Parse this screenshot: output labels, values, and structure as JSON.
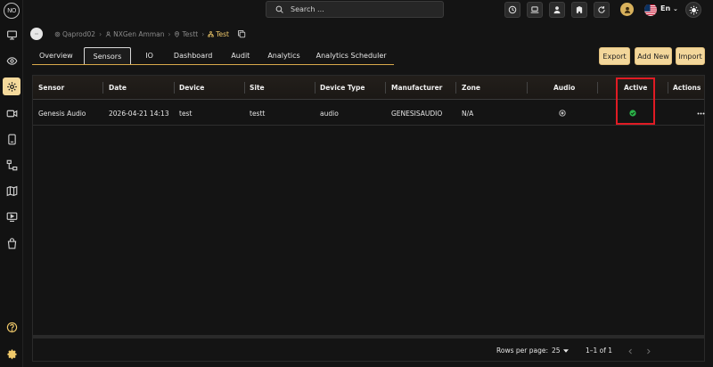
{
  "app": {
    "logo": "NO"
  },
  "search": {
    "placeholder": "Search ..."
  },
  "topbar": {
    "language": "En"
  },
  "breadcrumb": {
    "items": [
      "Qaprod02",
      "NXGen Amman",
      "Testt",
      "Test"
    ]
  },
  "tabs": [
    "Overview",
    "Sensors",
    "IO",
    "Dashboard",
    "Audit",
    "Analytics",
    "Analytics Scheduler"
  ],
  "active_tab": "Sensors",
  "actions": {
    "export": "Export",
    "add_new": "Add New",
    "import": "Import"
  },
  "table": {
    "columns": [
      "Sensor",
      "Date",
      "Device",
      "Site",
      "Device Type",
      "Manufacturer",
      "Zone",
      "Audio",
      "Active",
      "Actions"
    ],
    "rows": [
      {
        "sensor": "Genesis Audio",
        "date": "2026-04-21 14:13",
        "device": "test",
        "site": "testt",
        "device_type": "audio",
        "manufacturer": "GENESISAUDIO",
        "zone": "N/A"
      }
    ]
  },
  "pagination": {
    "rows_label": "Rows per page:",
    "rows_value": "25",
    "range": "1–1 of 1"
  },
  "colors": {
    "accent": "#f3d79b",
    "gold_text": "#f0c96a",
    "active_green": "#2bb24a",
    "highlight": "#e01b24",
    "background": "#141414"
  },
  "icons": {
    "sidebar": [
      "monitor-icon",
      "eye-icon",
      "settings-icon",
      "camera-icon",
      "device-icon",
      "hierarchy-icon",
      "map-icon",
      "video-icon",
      "bag-icon",
      "help-icon",
      "gear-icon"
    ],
    "topbar": [
      "clock-icon",
      "laptop-icon",
      "user-icon",
      "building-icon",
      "refresh-icon"
    ]
  }
}
